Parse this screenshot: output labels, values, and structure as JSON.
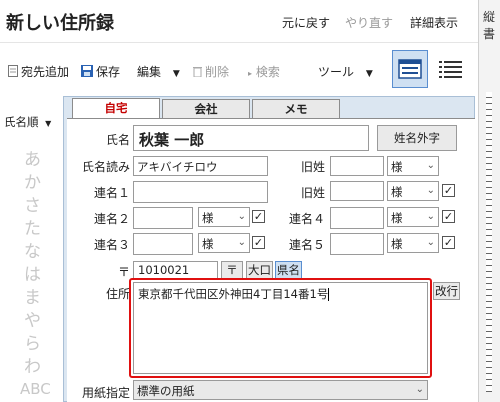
{
  "app": {
    "title": "新しい住所録"
  },
  "top": {
    "undo": "元に戻す",
    "redo": "やり直す",
    "detail": "詳細表示"
  },
  "right_pane": {
    "label": "縦書"
  },
  "toolbar": {
    "add": "宛先追加",
    "save": "保存",
    "edit": "編集",
    "delete": "削除",
    "search": "検索",
    "tools": "ツール"
  },
  "sidebar": {
    "sort_label": "氏名順",
    "kana": [
      "あ",
      "か",
      "さ",
      "た",
      "な",
      "は",
      "ま",
      "や",
      "ら",
      "わ",
      "ABC"
    ]
  },
  "tabs": [
    "自宅",
    "会社",
    "メモ"
  ],
  "form": {
    "name_label": "氏名",
    "name_value": "秋葉 一郎",
    "honorific_button": "姓名外字",
    "reading_label": "氏名読み",
    "reading_value": "アキバイチロウ",
    "old_name_label": "旧姓",
    "honorific": "様",
    "joint1_label": "連名１",
    "joint2_label": "連名２",
    "joint3_label": "連名３",
    "joint4_label": "連名４",
    "joint5_label": "連名５",
    "postal_mark": "〒",
    "postal_value": "1010021",
    "postal_btn": "〒",
    "ooguchi_btn": "大口",
    "jiname_btn": "県名",
    "address_label": "住所",
    "address_value": "東京都千代田区外神田4丁目14番1号",
    "newline_btn": "改行",
    "paper_label": "用紙指定",
    "paper_value": "標準の用紙"
  },
  "colors": {
    "accent": "#c40000",
    "highlight": "#e01010"
  }
}
